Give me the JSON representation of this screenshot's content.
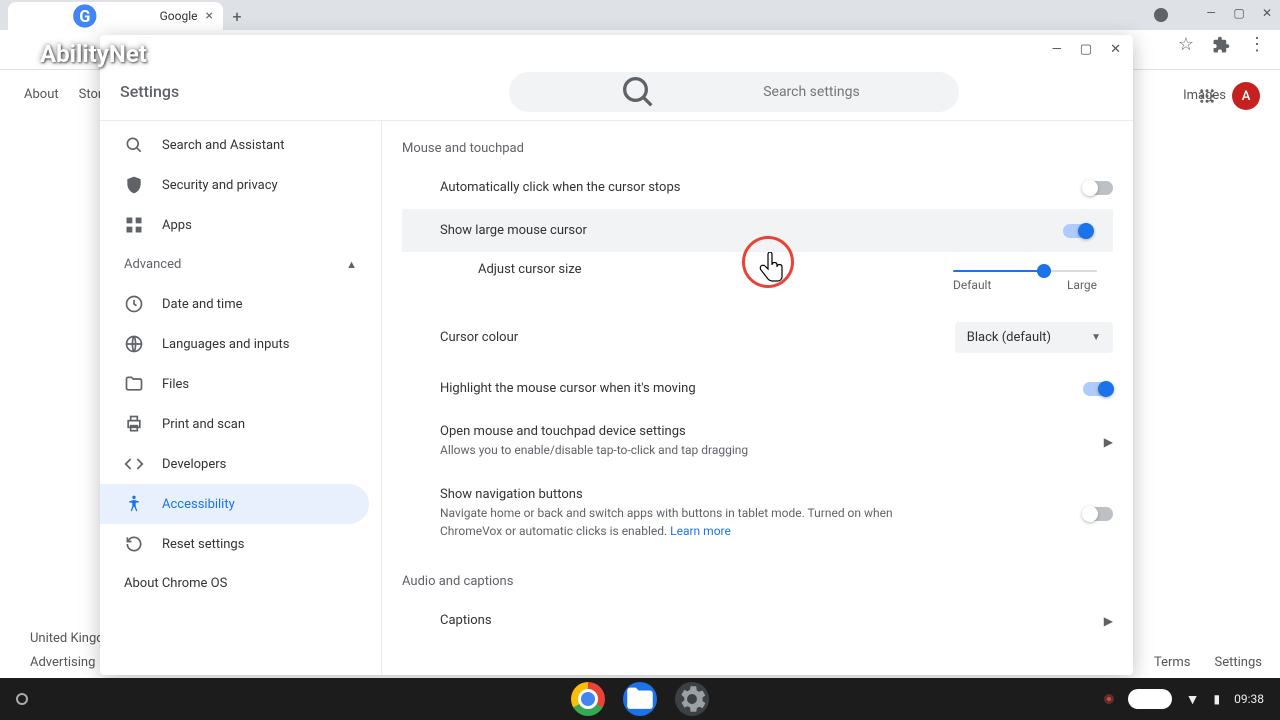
{
  "browser": {
    "tab_title": "Google",
    "watermark": "AbilityNet"
  },
  "bg": {
    "nav1": "About",
    "nav2": "Store",
    "images": "Images",
    "avatar_letter": "A",
    "uk": "United Kingdom",
    "adv": "Advertising",
    "terms": "Terms",
    "settings": "Settings"
  },
  "settings": {
    "title": "Settings",
    "search_placeholder": "Search settings",
    "advanced": "Advanced",
    "about": "About Chrome OS"
  },
  "sidebar": {
    "items": [
      {
        "label": "Search and Assistant"
      },
      {
        "label": "Security and privacy"
      },
      {
        "label": "Apps"
      },
      {
        "label": "Date and time"
      },
      {
        "label": "Languages and inputs"
      },
      {
        "label": "Files"
      },
      {
        "label": "Print and scan"
      },
      {
        "label": "Developers"
      },
      {
        "label": "Accessibility"
      },
      {
        "label": "Reset settings"
      }
    ]
  },
  "content": {
    "section1": "Mouse and touchpad",
    "auto_click": "Automatically click when the cursor stops",
    "large_cursor": "Show large mouse cursor",
    "adjust_label": "Adjust cursor size",
    "slider_default": "Default",
    "slider_large": "Large",
    "cursor_colour": "Cursor colour",
    "cursor_colour_value": "Black (default)",
    "highlight_moving": "Highlight the mouse cursor when it's moving",
    "open_device": "Open mouse and touchpad device settings",
    "open_device_sub": "Allows you to enable/disable tap-to-click and tap dragging",
    "nav_buttons": "Show navigation buttons",
    "nav_buttons_sub": "Navigate home or back and switch apps with buttons in tablet mode. Turned on when ChromeVox or automatic clicks is enabled.  ",
    "learn_more": "Learn more",
    "section2": "Audio and captions",
    "captions": "Captions"
  },
  "shelf": {
    "time": "09:38"
  }
}
